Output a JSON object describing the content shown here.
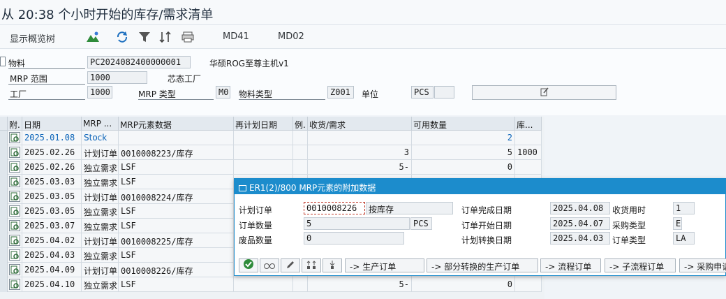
{
  "window": {
    "title": "从 20:38 个小时开始的库存/需求清单"
  },
  "toolbar": {
    "show_overview_tree": "显示概览树",
    "md41": "MD41",
    "md02": "MD02",
    "icons": [
      "mountain-icon",
      "refresh-icon",
      "filter-icon",
      "sort-icon",
      "print-icon"
    ]
  },
  "header": {
    "material_label": "物料",
    "material_value": "PC2024082400000001",
    "material_desc": "华硕ROG至尊主机v1",
    "mrp_area_label": "MRP 范围",
    "mrp_area_value": "1000",
    "mrp_area_desc": "芯态工厂",
    "plant_label": "工厂",
    "plant_value": "1000",
    "mrp_type_label": "MRP 类型",
    "mrp_type_value": "M0",
    "material_type_label": "物料类型",
    "material_type_value": "Z001",
    "unit_label": "单位",
    "unit_value": "PCS"
  },
  "grid": {
    "columns": [
      "附.",
      "日期",
      "MRP ...",
      "MRP元素数据",
      "再计划日期",
      "例.",
      "收货/需求",
      "可用数量",
      "库..."
    ],
    "rows": [
      {
        "date": "2025.01.08",
        "mrp": "Stock",
        "data": "",
        "replan": "",
        "ex": "",
        "recv": "",
        "avail": "2",
        "stor": ""
      },
      {
        "date": "2025.02.26",
        "mrp": "计划订单",
        "data": "0010008223/库存",
        "replan": "",
        "ex": "",
        "recv": "3",
        "avail": "5",
        "stor": "1000"
      },
      {
        "date": "2025.02.26",
        "mrp": "独立需求",
        "data": "LSF",
        "replan": "",
        "ex": "",
        "recv": "5-",
        "avail": "0",
        "stor": ""
      },
      {
        "date": "2025.03.03",
        "mrp": "独立需求",
        "data": "LSF",
        "replan": "",
        "ex": "",
        "recv": "",
        "avail": "",
        "stor": ""
      },
      {
        "date": "2025.03.05",
        "mrp": "计划订单",
        "data": "0010008224/库存",
        "replan": "",
        "ex": "",
        "recv": "",
        "avail": "",
        "stor": ""
      },
      {
        "date": "2025.03.05",
        "mrp": "独立需求",
        "data": "LSF",
        "replan": "",
        "ex": "",
        "recv": "",
        "avail": "",
        "stor": ""
      },
      {
        "date": "2025.03.07",
        "mrp": "独立需求",
        "data": "LSF",
        "replan": "",
        "ex": "",
        "recv": "",
        "avail": "",
        "stor": ""
      },
      {
        "date": "2025.04.02",
        "mrp": "计划订单",
        "data": "0010008225/库存",
        "replan": "",
        "ex": "",
        "recv": "",
        "avail": "",
        "stor": ""
      },
      {
        "date": "2025.04.03",
        "mrp": "独立需求",
        "data": "LSF",
        "replan": "",
        "ex": "",
        "recv": "",
        "avail": "",
        "stor": ""
      },
      {
        "date": "2025.04.09",
        "mrp": "计划订单",
        "data": "0010008226/库存",
        "replan": "",
        "ex": "",
        "recv": "",
        "avail": "",
        "stor": ""
      },
      {
        "date": "2025.04.10",
        "mrp": "独立需求",
        "data": "LSF",
        "replan": "",
        "ex": "",
        "recv": "5-",
        "avail": "0",
        "stor": ""
      }
    ]
  },
  "popup": {
    "title": "ER1(2)/800 MRP元素的附加数据",
    "planned_order_label": "计划订单",
    "planned_order_value": "0010008226",
    "planned_order_desc": "按库存",
    "order_qty_label": "订单数量",
    "order_qty_value": "5",
    "order_qty_unit": "PCS",
    "scrap_qty_label": "废品数量",
    "scrap_qty_value": "0",
    "finish_date_label": "订单完成日期",
    "finish_date_value": "2025.04.08",
    "gr_time_label": "收货用时",
    "gr_time_value": "1",
    "start_date_label": "订单开始日期",
    "start_date_value": "2025.04.07",
    "proc_type_label": "采购类型",
    "proc_type_value": "E",
    "conv_date_label": "计划转换日期",
    "conv_date_value": "2025.04.03",
    "order_type_label": "订单类型",
    "order_type_value": "LA",
    "buttons": {
      "prod_order": "-> 生产订单",
      "partial_conv": "-> 部分转换的生产订单",
      "process_order": "-> 流程订单",
      "sub_process": "-> 子流程订单",
      "purchase_req": "-> 采购申请"
    }
  }
}
